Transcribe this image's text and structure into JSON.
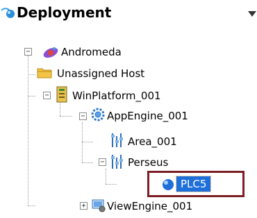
{
  "header": {
    "title": "Deployment",
    "icon": "deployment-icon",
    "dropdown_icon": "chevron-down-icon"
  },
  "tree": {
    "root": {
      "label": "Andromeda",
      "icon": "galaxy-icon",
      "expanded": true
    },
    "unassigned": {
      "label": "Unassigned Host",
      "icon": "folder-icon"
    },
    "platform": {
      "label": "WinPlatform_001",
      "icon": "platform-icon",
      "expanded": true
    },
    "appengine": {
      "label": "AppEngine_001",
      "icon": "engine-gear-icon",
      "expanded": true
    },
    "area": {
      "label": "Area_001",
      "icon": "area-icon"
    },
    "perseus": {
      "label": "Perseus",
      "icon": "area-icon",
      "expanded": true
    },
    "plc5": {
      "label": "PLC5",
      "icon": "blue-sphere-icon",
      "selected": true
    },
    "viewengine": {
      "label": "ViewEngine_001",
      "icon": "viewengine-icon",
      "expanded": false
    }
  },
  "colors": {
    "selection": "#1e6fd9",
    "highlight_border": "#7b1e24"
  }
}
